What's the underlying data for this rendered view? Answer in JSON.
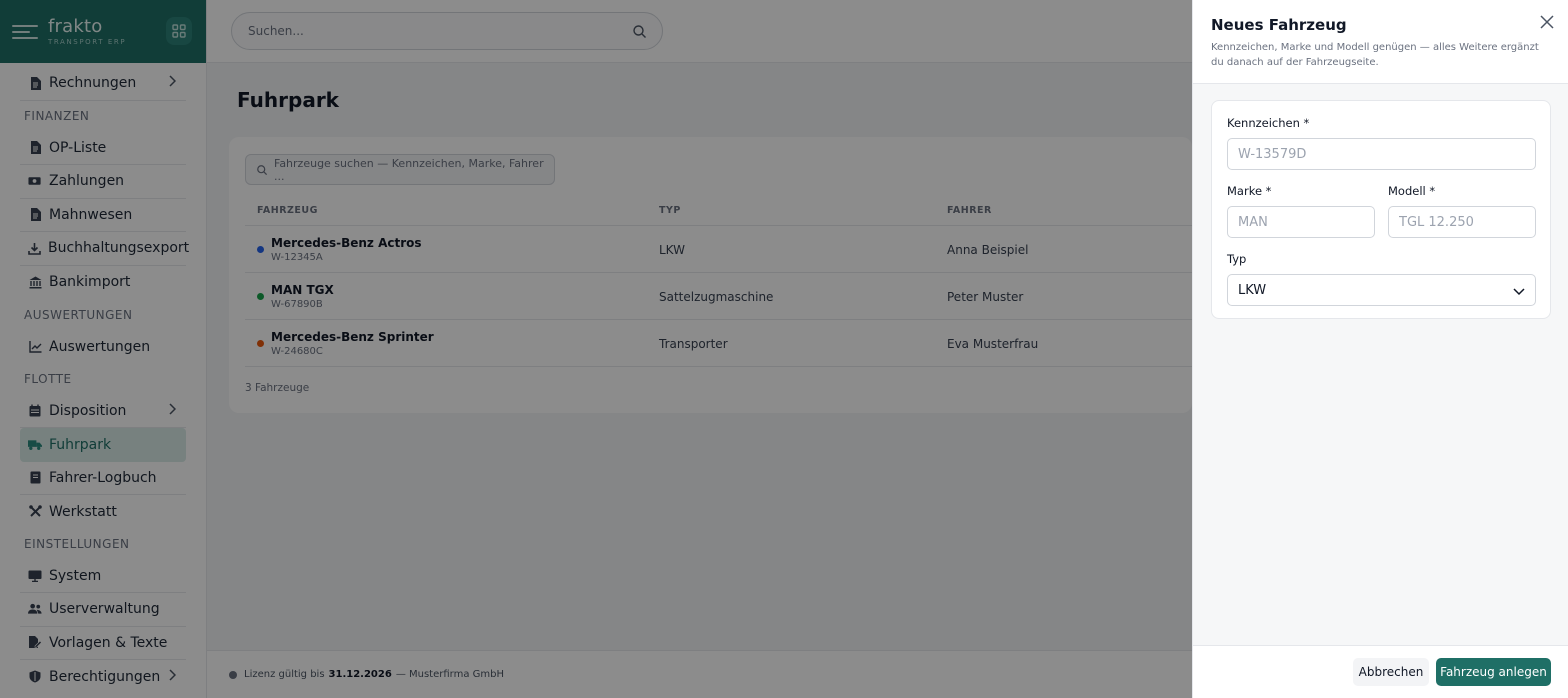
{
  "brand": {
    "name": "frakto",
    "tagline": "TRANSPORT ERP"
  },
  "sidebar": {
    "items": [
      {
        "label": "Rechnungen",
        "icon": "document-icon",
        "chevron": true
      },
      {
        "section": "FINANZEN"
      },
      {
        "label": "OP-Liste",
        "icon": "document-icon"
      },
      {
        "label": "Zahlungen",
        "icon": "money-icon"
      },
      {
        "label": "Mahnwesen",
        "icon": "document-icon"
      },
      {
        "label": "Buchhaltungsexport",
        "icon": "download-icon"
      },
      {
        "label": "Bankimport",
        "icon": "bank-icon"
      },
      {
        "section": "AUSWERTUNGEN"
      },
      {
        "label": "Auswertungen",
        "icon": "chart-icon"
      },
      {
        "section": "FLOTTE"
      },
      {
        "label": "Disposition",
        "icon": "calendar-icon",
        "chevron": true
      },
      {
        "label": "Fuhrpark",
        "icon": "truck-icon",
        "active": true
      },
      {
        "label": "Fahrer-Logbuch",
        "icon": "book-icon"
      },
      {
        "label": "Werkstatt",
        "icon": "tools-icon"
      },
      {
        "section": "EINSTELLUNGEN"
      },
      {
        "label": "System",
        "icon": "monitor-icon"
      },
      {
        "label": "Userverwaltung",
        "icon": "users-icon"
      },
      {
        "label": "Vorlagen & Texte",
        "icon": "file-edit-icon"
      },
      {
        "label": "Berechtigungen",
        "icon": "shield-icon",
        "chevron": true
      }
    ]
  },
  "topbar": {
    "search_placeholder": "Suchen..."
  },
  "page": {
    "title": "Fuhrpark"
  },
  "fleet": {
    "search_placeholder": "Fahrzeuge suchen — Kennzeichen, Marke, Fahrer ...",
    "columns": [
      "FAHRZEUG",
      "TYP",
      "FAHRER"
    ],
    "rows": [
      {
        "name": "Mercedes-Benz Actros",
        "plate": "W-12345A",
        "type": "LKW",
        "driver": "Anna Beispiel",
        "color": "#2563eb"
      },
      {
        "name": "MAN TGX",
        "plate": "W-67890B",
        "type": "Sattelzugmaschine",
        "driver": "Peter Muster",
        "color": "#16a34a"
      },
      {
        "name": "Mercedes-Benz Sprinter",
        "plate": "W-24680C",
        "type": "Transporter",
        "driver": "Eva Musterfrau",
        "color": "#ea580c"
      }
    ],
    "count": "3 Fahrzeuge"
  },
  "footer": {
    "license_prefix": "Lizenz gültig bis",
    "license_date": "31.12.2026",
    "company": "— Musterfirma GmbH"
  },
  "drawer": {
    "title": "Neues Fahrzeug",
    "subtitle": "Kennzeichen, Marke und Modell genügen — alles Weitere ergänzt du danach auf der Fahrzeugseite.",
    "fields": {
      "plate": {
        "label": "Kennzeichen *",
        "placeholder": "W-13579D",
        "value": ""
      },
      "brand": {
        "label": "Marke *",
        "placeholder": "MAN",
        "value": ""
      },
      "model": {
        "label": "Modell *",
        "placeholder": "TGL 12.250",
        "value": ""
      },
      "type": {
        "label": "Typ",
        "value": "LKW"
      }
    },
    "cancel_label": "Abbrechen",
    "submit_label": "Fahrzeug anlegen"
  },
  "colors": {
    "brand": "#1f6f66",
    "active_bg": "#d9ebe8"
  }
}
